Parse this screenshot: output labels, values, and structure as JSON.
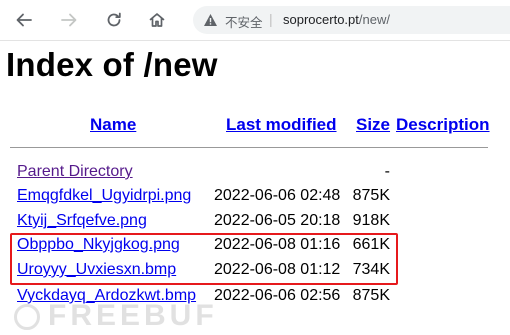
{
  "browser": {
    "back_icon": "arrow-left-icon",
    "forward_icon": "arrow-right-icon",
    "reload_icon": "reload-icon",
    "home_icon": "home-icon",
    "security_icon": "warning-triangle-icon",
    "security_label": "不安全",
    "url_host": "soprocerto.pt",
    "url_path": "/new/"
  },
  "page": {
    "title": "Index of /new",
    "columns": {
      "name": "Name",
      "last_modified": "Last modified",
      "size": "Size",
      "description": "Description"
    },
    "parent": {
      "label": "Parent Directory",
      "size": "-"
    },
    "files": [
      {
        "name": "Emqgfdkel_Ugyidrpi.png",
        "modified": "2022-06-06 02:48",
        "size": "875K"
      },
      {
        "name": "Ktyij_Srfqefve.png",
        "modified": "2022-06-05 20:18",
        "size": "918K"
      },
      {
        "name": "Obppbo_Nkyjgkog.png",
        "modified": "2022-06-08 01:16",
        "size": "661K"
      },
      {
        "name": "Uroyyy_Uvxiesxn.bmp",
        "modified": "2022-06-08 01:12",
        "size": "734K"
      },
      {
        "name": "Vyckdayq_Ardozkwt.bmp",
        "modified": "2022-06-06 02:56",
        "size": "875K"
      }
    ]
  },
  "annotation": {
    "highlight_color": "#e6191c"
  },
  "watermark": {
    "text": "FREEBUF"
  }
}
